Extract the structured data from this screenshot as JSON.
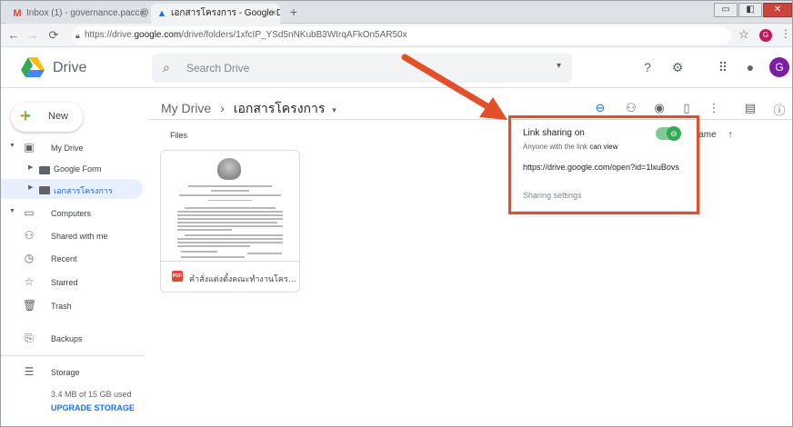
{
  "browser": {
    "tabs": [
      {
        "title": "Inbox (1) - governance.pacc@gm",
        "close": "×",
        "favicon": "M"
      },
      {
        "title": "เอกสารโครงการ - Google Drive",
        "close": "×",
        "favicon": "▲"
      }
    ],
    "new_tab": "+",
    "window_controls": {
      "minimize": "▭",
      "maximize": "◧",
      "close": "✕"
    },
    "url_prefix": "https://drive.",
    "url_host": "google.com",
    "url_path": "/drive/folders/1xfcIP_YSd5nNKubB3WIrqAFkOn5AR50x",
    "profile_initial": "G"
  },
  "drive": {
    "app_name": "Drive",
    "search_placeholder": "Search Drive",
    "account_initial": "G",
    "new_label": "New",
    "sidebar": {
      "my_drive": "My Drive",
      "google_form": "Google Form",
      "project_docs": "เอกสารโครงการ",
      "computers": "Computers",
      "shared": "Shared with me",
      "recent": "Recent",
      "starred": "Starred",
      "trash": "Trash",
      "backups": "Backups",
      "storage": "Storage",
      "storage_used": "3.4 MB of 15 GB used",
      "upgrade": "UPGRADE STORAGE"
    },
    "breadcrumb": {
      "root": "My Drive",
      "separator": "›",
      "current": "เอกสารโครงการ"
    },
    "files_label": "Files",
    "sort_label": "Name",
    "sort_arrow": "↑",
    "file": {
      "name": "คำสั่งแต่งตั้งคณะทำงานโครงก...",
      "type_badge": "PDF"
    },
    "share_popup": {
      "title": "Link sharing on",
      "subtitle_prefix": "Anyone with the link",
      "subtitle_perm": "can view",
      "url": "https://drive.google.com/open?id=1lxuBovs",
      "settings": "Sharing settings"
    }
  },
  "colors": {
    "accent": "#1a73e8",
    "highlight": "#e1502a",
    "toggle": "#34a853"
  }
}
